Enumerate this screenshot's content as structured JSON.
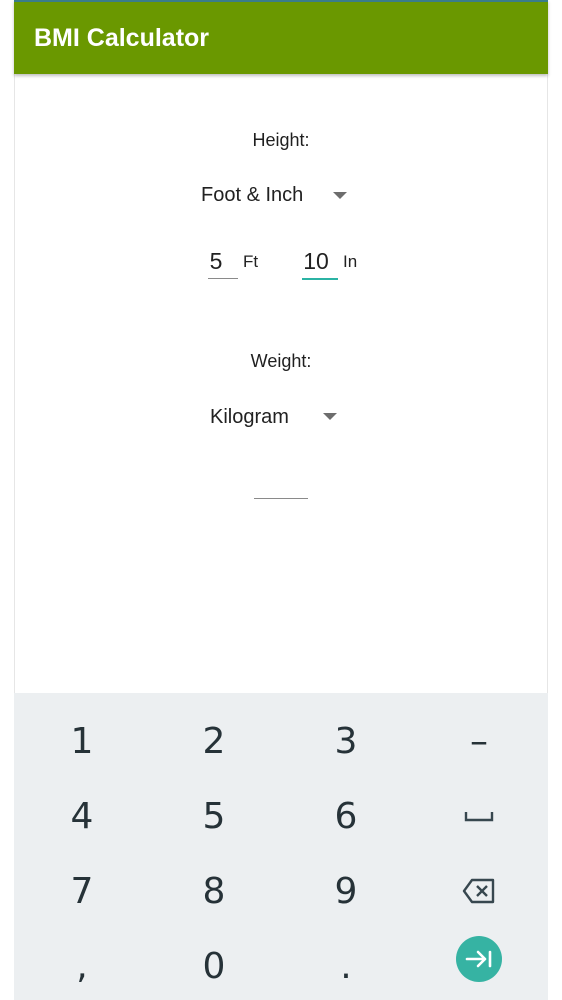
{
  "app": {
    "title": "BMI Calculator"
  },
  "height": {
    "label": "Height:",
    "unit_selected": "Foot & Inch",
    "feet_value": "5",
    "feet_unit": "Ft",
    "inch_value": "10",
    "inch_unit": "In"
  },
  "weight": {
    "label": "Weight:",
    "unit_selected": "Kilogram",
    "value": ""
  },
  "keyboard": {
    "row1": [
      "1",
      "2",
      "3",
      "–"
    ],
    "row2": [
      "4",
      "5",
      "6"
    ],
    "row3": [
      "7",
      "8",
      "9"
    ],
    "row4": [
      ",",
      "0",
      "."
    ]
  },
  "colors": {
    "appbar": "#6a9800",
    "accent": "#2bb3a4",
    "keyboard_bg": "#eceff1"
  }
}
